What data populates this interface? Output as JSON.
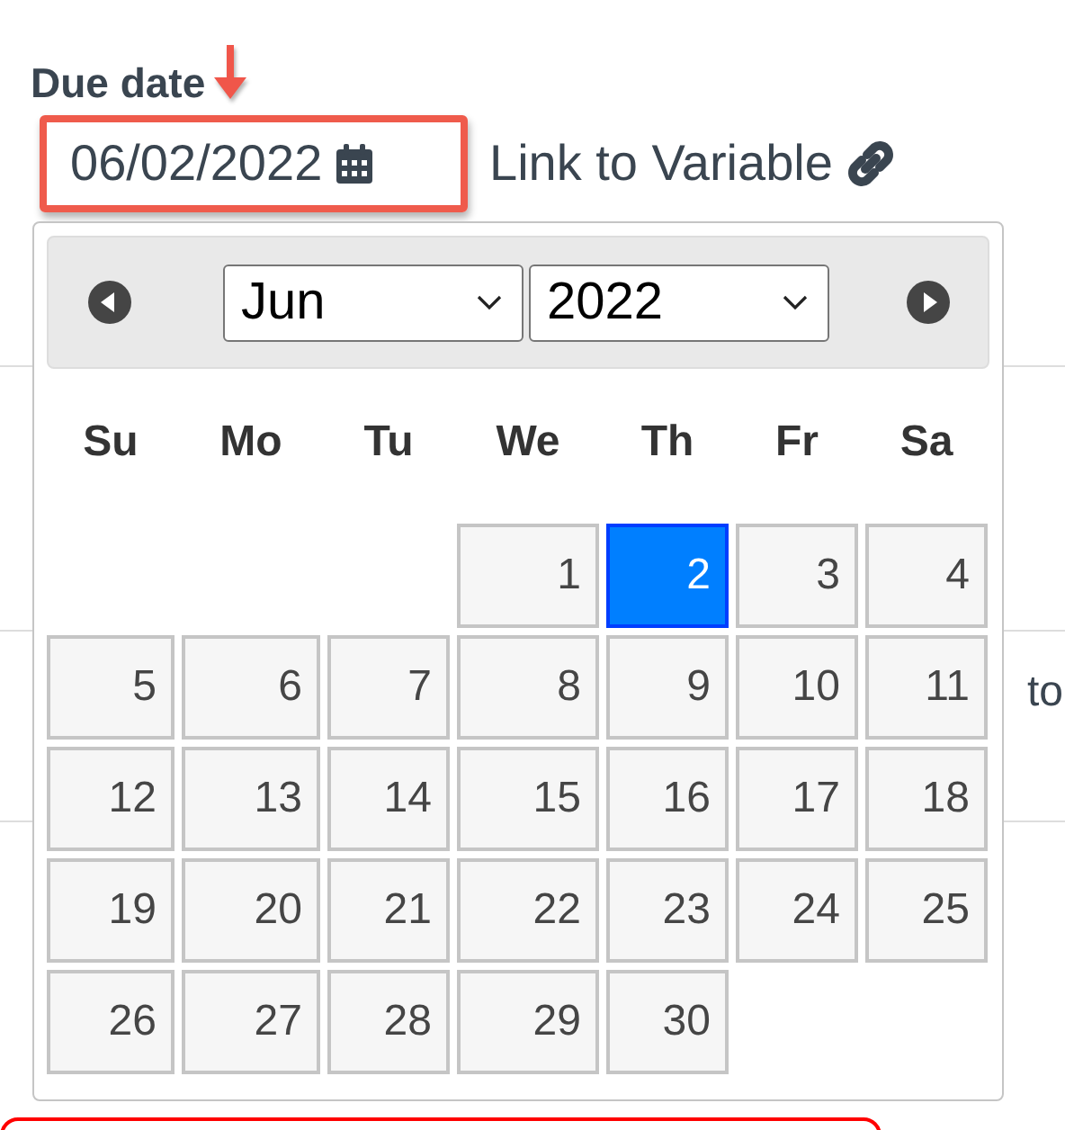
{
  "field": {
    "label": "Due date",
    "value": "06/02/2022",
    "highlighted": true,
    "link_text": "Link to Variable"
  },
  "calendar": {
    "month": "Jun",
    "year": "2022",
    "weekdays": [
      "Su",
      "Mo",
      "Tu",
      "We",
      "Th",
      "Fr",
      "Sa"
    ],
    "weeks": [
      [
        {
          "kind": "blank"
        },
        {
          "kind": "blank"
        },
        {
          "kind": "blank"
        },
        {
          "kind": "day",
          "day": "1",
          "selected": false
        },
        {
          "kind": "day",
          "day": "2",
          "selected": true
        },
        {
          "kind": "day",
          "day": "3",
          "selected": false
        },
        {
          "kind": "day",
          "day": "4",
          "selected": false
        }
      ],
      [
        {
          "kind": "day",
          "day": "5",
          "selected": false
        },
        {
          "kind": "day",
          "day": "6",
          "selected": false
        },
        {
          "kind": "day",
          "day": "7",
          "selected": false
        },
        {
          "kind": "day",
          "day": "8",
          "selected": false
        },
        {
          "kind": "day",
          "day": "9",
          "selected": false
        },
        {
          "kind": "day",
          "day": "10",
          "selected": false
        },
        {
          "kind": "day",
          "day": "11",
          "selected": false
        }
      ],
      [
        {
          "kind": "day",
          "day": "12",
          "selected": false
        },
        {
          "kind": "day",
          "day": "13",
          "selected": false
        },
        {
          "kind": "day",
          "day": "14",
          "selected": false
        },
        {
          "kind": "day",
          "day": "15",
          "selected": false
        },
        {
          "kind": "day",
          "day": "16",
          "selected": false
        },
        {
          "kind": "day",
          "day": "17",
          "selected": false
        },
        {
          "kind": "day",
          "day": "18",
          "selected": false
        }
      ],
      [
        {
          "kind": "day",
          "day": "19",
          "selected": false
        },
        {
          "kind": "day",
          "day": "20",
          "selected": false
        },
        {
          "kind": "day",
          "day": "21",
          "selected": false
        },
        {
          "kind": "day",
          "day": "22",
          "selected": false
        },
        {
          "kind": "day",
          "day": "23",
          "selected": false
        },
        {
          "kind": "day",
          "day": "24",
          "selected": false
        },
        {
          "kind": "day",
          "day": "25",
          "selected": false
        }
      ],
      [
        {
          "kind": "day",
          "day": "26",
          "selected": false
        },
        {
          "kind": "day",
          "day": "27",
          "selected": false
        },
        {
          "kind": "day",
          "day": "28",
          "selected": false
        },
        {
          "kind": "day",
          "day": "29",
          "selected": false
        },
        {
          "kind": "day",
          "day": "30",
          "selected": false
        },
        {
          "kind": "blank"
        },
        {
          "kind": "blank"
        }
      ]
    ]
  },
  "behind_text": "to"
}
